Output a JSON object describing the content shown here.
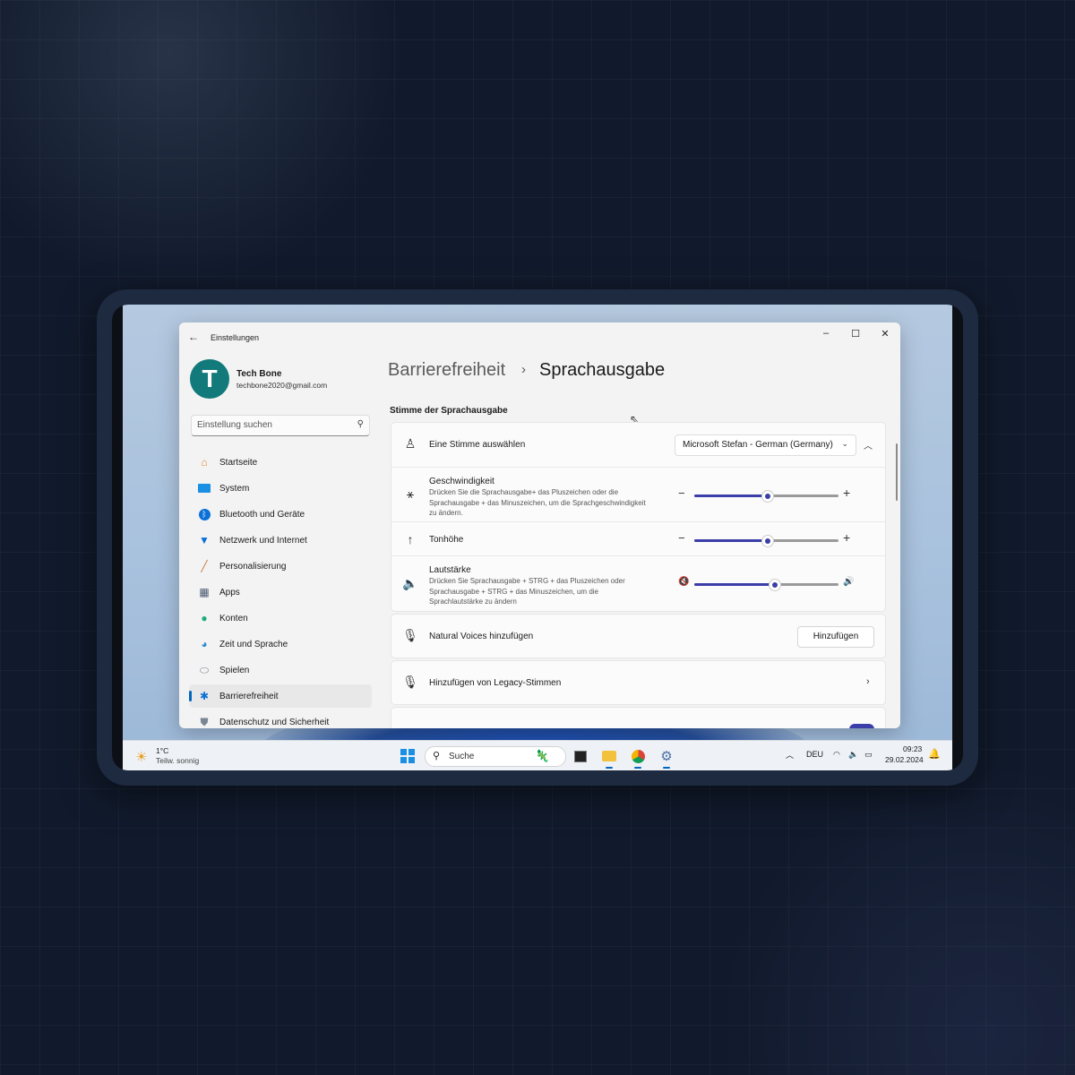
{
  "window": {
    "title": "Einstellungen",
    "controls": {
      "minimize": "–",
      "maximize": "☐",
      "close": "✕"
    }
  },
  "user": {
    "initial": "T",
    "name": "Tech Bone",
    "email": "techbone2020@gmail.com"
  },
  "search": {
    "placeholder": "Einstellung suchen"
  },
  "sidebar": {
    "items": [
      {
        "label": "Startseite",
        "icon": "home-icon"
      },
      {
        "label": "System",
        "icon": "monitor-icon"
      },
      {
        "label": "Bluetooth und Geräte",
        "icon": "bluetooth-icon"
      },
      {
        "label": "Netzwerk und Internet",
        "icon": "wifi-icon"
      },
      {
        "label": "Personalisierung",
        "icon": "brush-icon"
      },
      {
        "label": "Apps",
        "icon": "apps-icon"
      },
      {
        "label": "Konten",
        "icon": "person-icon"
      },
      {
        "label": "Zeit und Sprache",
        "icon": "globe-clock-icon"
      },
      {
        "label": "Spielen",
        "icon": "gamepad-icon"
      },
      {
        "label": "Barrierefreiheit",
        "icon": "accessibility-icon",
        "active": true
      },
      {
        "label": "Datenschutz und Sicherheit",
        "icon": "shield-icon"
      }
    ]
  },
  "breadcrumb": {
    "parent": "Barrierefreiheit",
    "separator": "›",
    "current": "Sprachausgabe"
  },
  "section": {
    "title": "Stimme der Sprachausgabe"
  },
  "voice_card": {
    "select_voice": {
      "label": "Eine Stimme auswählen",
      "value": "Microsoft Stefan - German (Germany)"
    },
    "speed": {
      "label": "Geschwindigkeit",
      "description": "Drücken Sie die Sprachausgabe+ das Pluszeichen oder die Sprachausgabe + das Minuszeichen, um die Sprachgeschwindigkeit zu ändern.",
      "value": 0.5
    },
    "pitch": {
      "label": "Tonhöhe",
      "value": 0.5
    },
    "volume": {
      "label": "Lautstärke",
      "description": "Drücken Sie Sprachausgabe + STRG + das Pluszeichen oder Sprachausgabe + STRG + das Minuszeichen, um die Sprachlautstärke zu ändern",
      "value": 0.55
    }
  },
  "natural_voices": {
    "label": "Natural Voices hinzufügen",
    "button": "Hinzufügen"
  },
  "legacy_voices": {
    "label": "Hinzufügen von Legacy-Stimmen"
  },
  "taskbar": {
    "weather": {
      "temp": "1°C",
      "condition": "Teilw. sonnig"
    },
    "search_label": "Suche",
    "language": "DEU",
    "time": "09:23",
    "date": "29.02.2024"
  },
  "colors": {
    "accent": "#3b3ea8",
    "avatar": "#127a7a",
    "windows_blue": "#0067c0"
  }
}
